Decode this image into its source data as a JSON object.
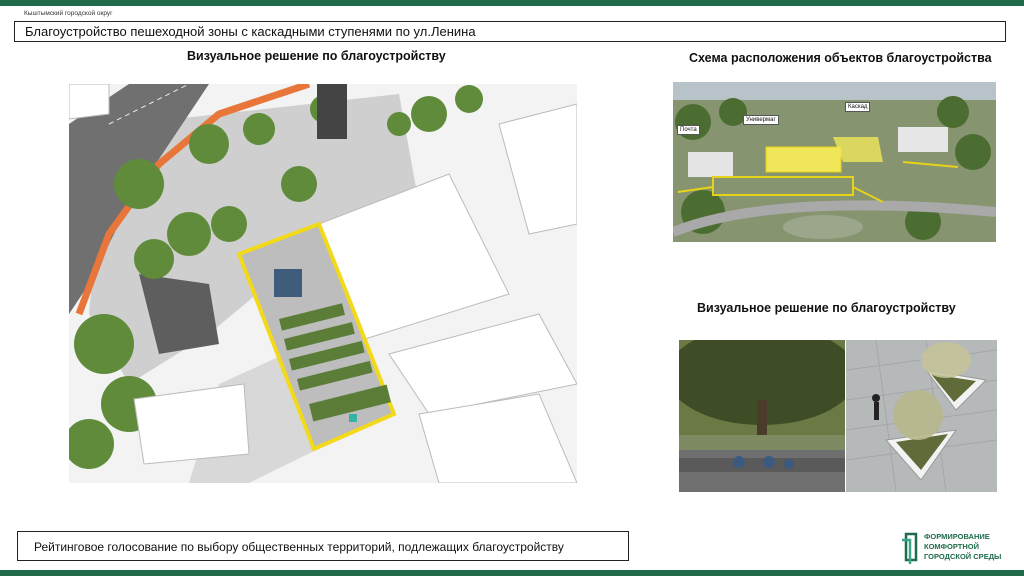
{
  "header": {
    "org": "Кыштымский  городской округ",
    "title": "Благоустройство пешеходной зоны с каскадными ступенями по ул.Ленина"
  },
  "headings": {
    "left": "Визуальное решение по благоустройству",
    "scheme": "Схема расположения объектов благоустройства",
    "right": "Визуальное решение по благоустройству"
  },
  "scheme_labels": {
    "post": "Почта",
    "univermag": "Универмаг",
    "kaskad": "Каскад"
  },
  "footer": {
    "text": "Рейтинговое голосование по выбору общественных территорий,  подлежащих  благоустройству"
  },
  "logo": {
    "line1": "ФОРМИРОВАНИЕ",
    "line2": "КОМФОРТНОЙ",
    "line3": "ГОРОДСКОЙ СРЕДЫ"
  },
  "colors": {
    "brand": "#1f6b4a",
    "highlight": "#f2d91a",
    "road_accent": "#e8763a"
  }
}
